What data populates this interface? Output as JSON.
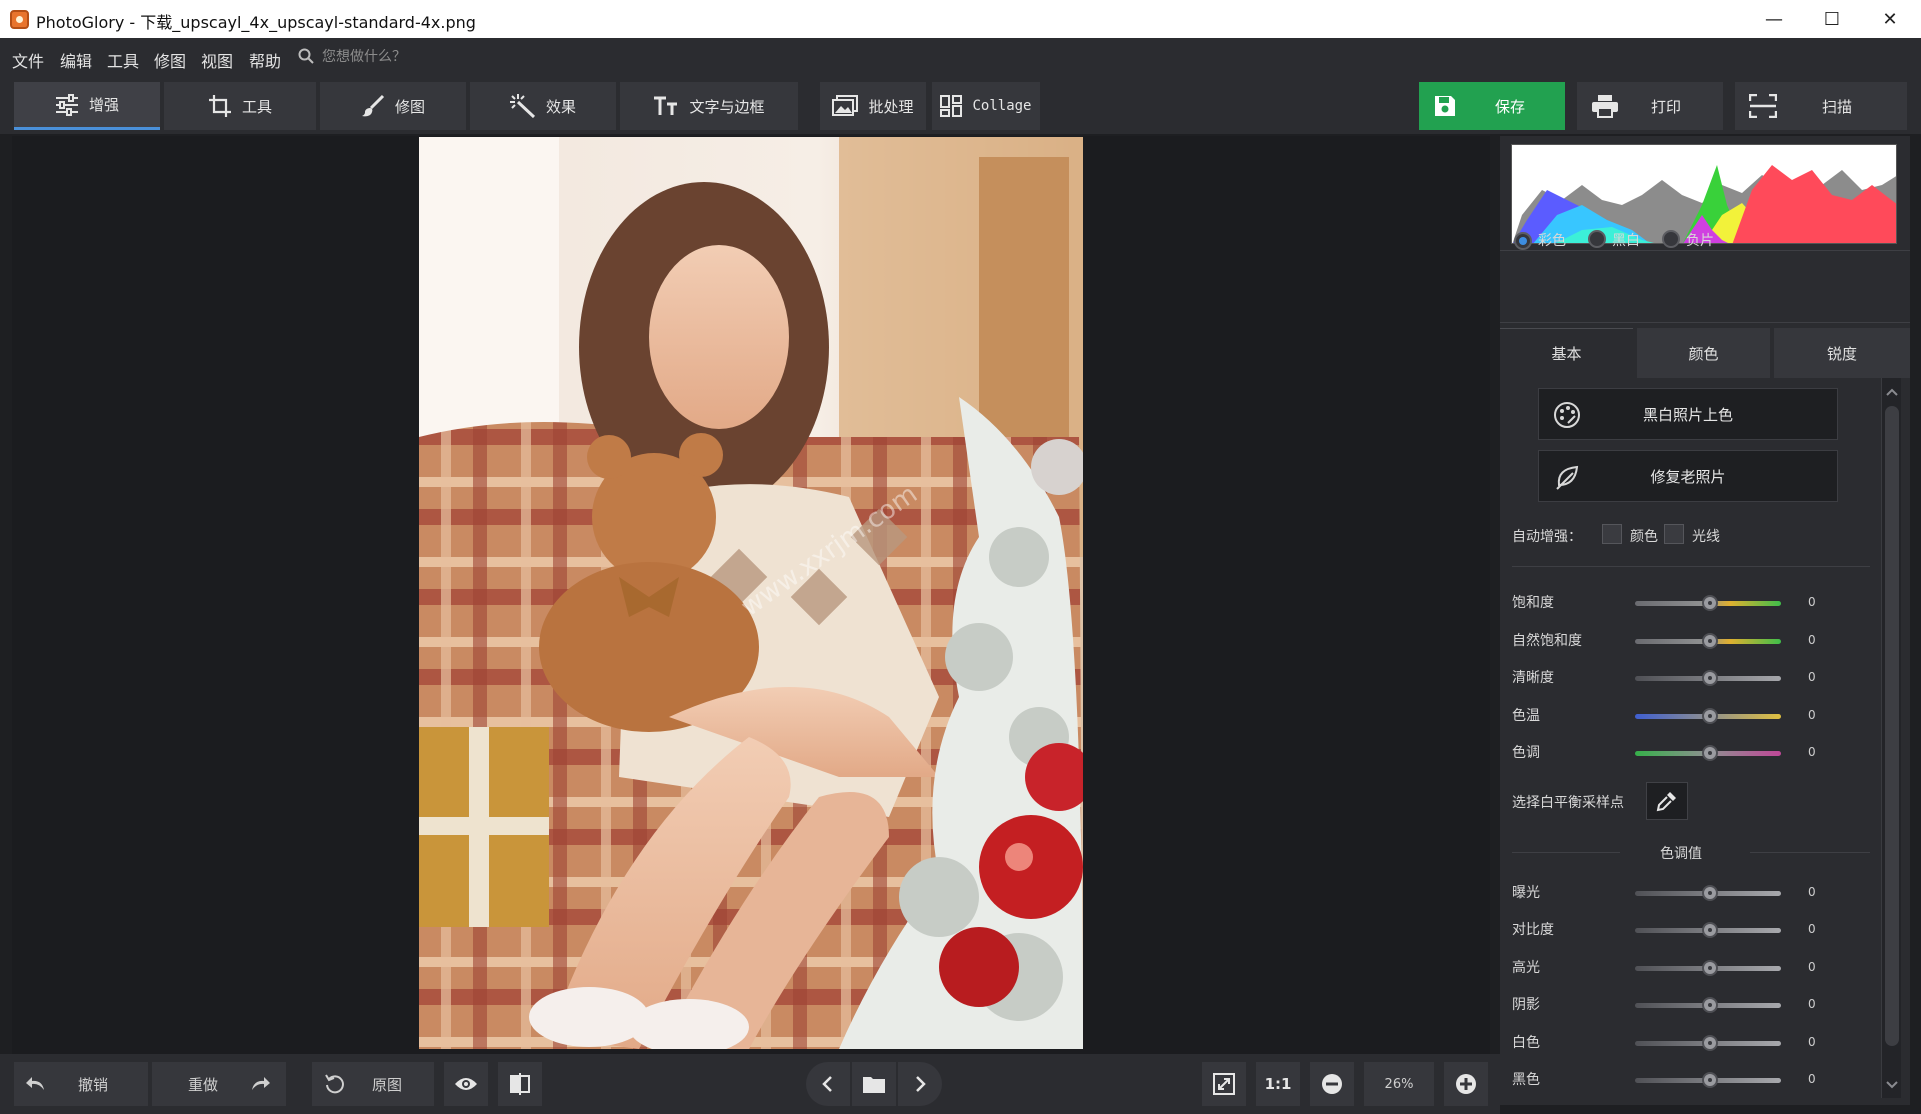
{
  "window": {
    "title": "PhotoGlory - 下载_upscayl_4x_upscayl-standard-4x.png",
    "minimize": "—",
    "maximize": "☐",
    "close": "✕"
  },
  "menu": {
    "items": [
      "文件",
      "编辑",
      "工具",
      "修图",
      "视图",
      "帮助"
    ],
    "search_placeholder": "您想做什么？"
  },
  "toolbar": {
    "enhance": "增强",
    "tools": "工具",
    "retouch": "修图",
    "effects": "效果",
    "text_frames": "文字与边框",
    "batch": "批处理",
    "collage": "Collage",
    "save": "保存",
    "print": "打印",
    "scan": "扫描"
  },
  "photo": {
    "watermark": "www.xxrjm.com"
  },
  "panel": {
    "modes": [
      {
        "label": "彩色",
        "selected": true
      },
      {
        "label": "黑白",
        "selected": false
      },
      {
        "label": "负片",
        "selected": false
      }
    ],
    "tabs": [
      "基本",
      "颜色",
      "锐度"
    ],
    "colorize_button": "黑白照片上色",
    "restore_button": "修复老照片",
    "auto_enhance_label": "自动增强：",
    "auto_color_label": "颜色",
    "auto_light_label": "光线",
    "color_sliders": [
      {
        "label": "饱和度",
        "value": "0"
      },
      {
        "label": "自然饱和度",
        "value": "0"
      },
      {
        "label": "清晰度",
        "value": "0"
      },
      {
        "label": "色温",
        "value": "0"
      },
      {
        "label": "色调",
        "value": "0"
      }
    ],
    "white_balance_label": "选择白平衡采样点",
    "tone_section_title": "色调值",
    "tone_sliders": [
      {
        "label": "曝光",
        "value": "0"
      },
      {
        "label": "对比度",
        "value": "0"
      },
      {
        "label": "高光",
        "value": "0"
      },
      {
        "label": "阴影",
        "value": "0"
      },
      {
        "label": "白色",
        "value": "0"
      },
      {
        "label": "黑色",
        "value": "0"
      }
    ]
  },
  "bottom": {
    "undo": "撤销",
    "redo": "重做",
    "original": "原图",
    "one_to_one": "1:1",
    "zoom": "26%"
  },
  "colors": {
    "accent": "#3d8de0",
    "save_green": "#22a150",
    "panel_bg": "#2b2c30",
    "canvas_bg": "#1b1c1f"
  }
}
